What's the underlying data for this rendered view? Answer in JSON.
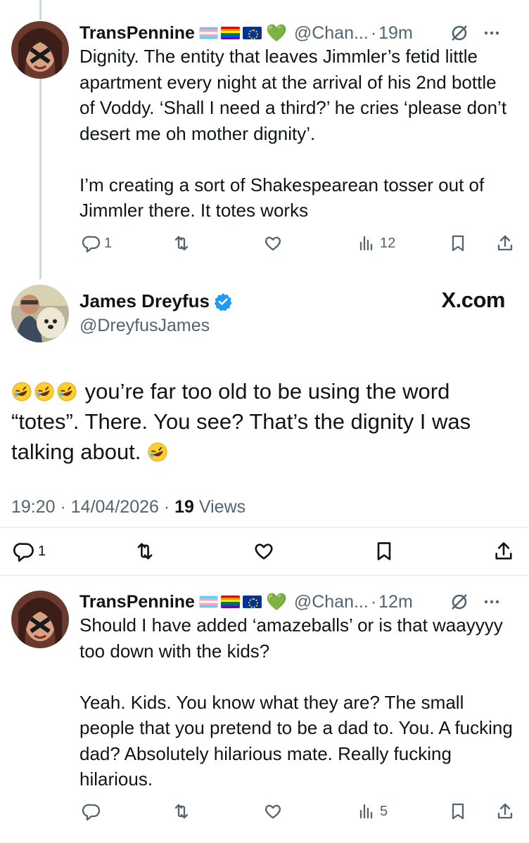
{
  "reply1": {
    "name": "TransPennine",
    "handle": "@Chan...",
    "dot": "·",
    "time": "19m",
    "text": "Dignity. The entity that leaves Jimmler’s fetid little apartment every night at the arrival of his 2nd bottle of Voddy. ‘Shall I need a third?’ he cries ‘please don’t desert me oh mother dignity’.\n\nI’m creating a sort of Shakespearean tosser out of Jimmler there. It totes works",
    "replies": "1",
    "views": "12"
  },
  "main": {
    "name": "James Dreyfus",
    "handle": "@DreyfusJames",
    "watermark": "X.com",
    "text_after_emoji": " you’re far too old to be using the word “totes”. There. You see? That’s the dignity I was talking about. ",
    "timestamp": "19:20 · 14/04/2026 · ",
    "views_count": "19",
    "views_label": " Views",
    "replies": "1"
  },
  "reply2": {
    "name": "TransPennine",
    "handle": "@Chan...",
    "dot": "·",
    "time": "12m",
    "text": "Should I have added ‘amazeballs’ or is that waayyyy too down with the kids?\n\nYeah. Kids. You know what they are? The small people that you pretend to be a dad to. You. A fucking dad? Absolutely hilarious mate. Really fucking hilarious.",
    "views": "5"
  },
  "colors": {
    "text": "#0f1419",
    "muted": "#536471",
    "verified": "#1d9bf0",
    "thread_line": "#cfd9de"
  }
}
